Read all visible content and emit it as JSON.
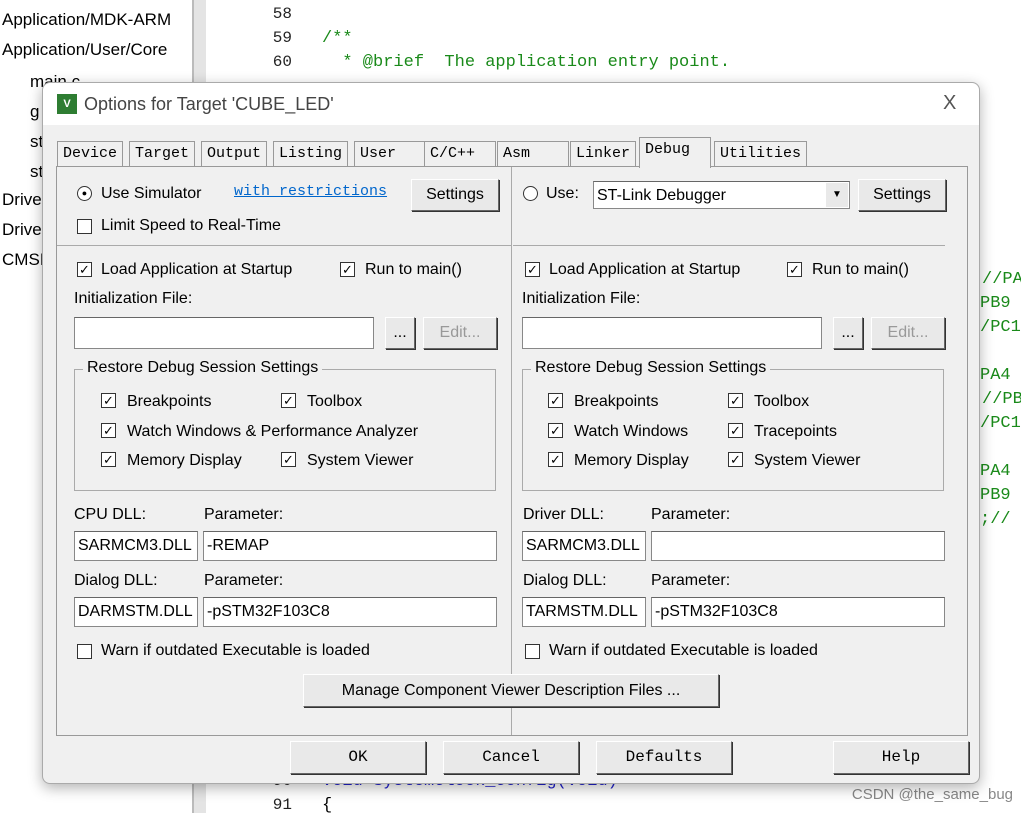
{
  "tree": {
    "items": [
      "Application/MDK-ARM",
      "Application/User/Core",
      "main.c",
      "g",
      "st",
      "st",
      "Drive",
      "Drive",
      "CMSI"
    ]
  },
  "editor": {
    "lines": [
      {
        "n": "58",
        "t": ""
      },
      {
        "n": "59",
        "t": "/**"
      },
      {
        "n": "60",
        "t": "  * @brief  The application entry point."
      },
      {
        "n": "90",
        "t": "void SystemClock_Config(void)"
      },
      {
        "n": "91",
        "t": "{"
      }
    ],
    "right_snippets": [
      "//PA",
      "PB9",
      "/PC1",
      "PA4",
      "//PB",
      "/PC1",
      "PA4",
      "PB9",
      ";//"
    ]
  },
  "dialog": {
    "title": "Options for Target 'CUBE_LED'",
    "close": "X",
    "tabs": [
      "Device",
      "Target",
      "Output",
      "Listing",
      "User",
      "C/C++",
      "Asm",
      "Linker",
      "Debug",
      "Utilities"
    ],
    "active_tab": "Debug",
    "left": {
      "use_simulator": "Use Simulator",
      "simulator_selected": true,
      "with_restrictions": "with restrictions",
      "settings": "Settings",
      "limit_speed": "Limit Speed to Real-Time",
      "limit_speed_checked": false,
      "load_app": "Load Application at Startup",
      "run_to_main": "Run to main()",
      "init_file_label": "Initialization File:",
      "init_file": "",
      "browse": "...",
      "edit": "Edit...",
      "restore_group": "Restore Debug Session Settings",
      "breakpoints": "Breakpoints",
      "toolbox": "Toolbox",
      "watch": "Watch Windows & Performance Analyzer",
      "memory": "Memory Display",
      "system_viewer": "System Viewer",
      "cpu_dll_label": "CPU DLL:",
      "param_label": "Parameter:",
      "cpu_dll": "SARMCM3.DLL",
      "cpu_param": "-REMAP",
      "dialog_dll_label": "Dialog DLL:",
      "dialog_dll": "DARMSTM.DLL",
      "dialog_param": "-pSTM32F103C8",
      "warn": "Warn if outdated Executable is loaded"
    },
    "right": {
      "use": "Use:",
      "debugger": "ST-Link Debugger",
      "settings": "Settings",
      "load_app": "Load Application at Startup",
      "run_to_main": "Run to main()",
      "init_file_label": "Initialization File:",
      "init_file": "",
      "browse": "...",
      "edit": "Edit...",
      "restore_group": "Restore Debug Session Settings",
      "breakpoints": "Breakpoints",
      "toolbox": "Toolbox",
      "watch": "Watch Windows",
      "tracepoints": "Tracepoints",
      "memory": "Memory Display",
      "system_viewer": "System Viewer",
      "driver_dll_label": "Driver DLL:",
      "param_label": "Parameter:",
      "driver_dll": "SARMCM3.DLL",
      "driver_param": "",
      "dialog_dll_label": "Dialog DLL:",
      "dialog_dll": "TARMSTM.DLL",
      "dialog_param": "-pSTM32F103C8",
      "warn": "Warn if outdated Executable is loaded"
    },
    "manage": "Manage Component Viewer Description Files ...",
    "buttons": {
      "ok": "OK",
      "cancel": "Cancel",
      "defaults": "Defaults",
      "help": "Help"
    }
  },
  "watermark": "CSDN @the_same_bug"
}
